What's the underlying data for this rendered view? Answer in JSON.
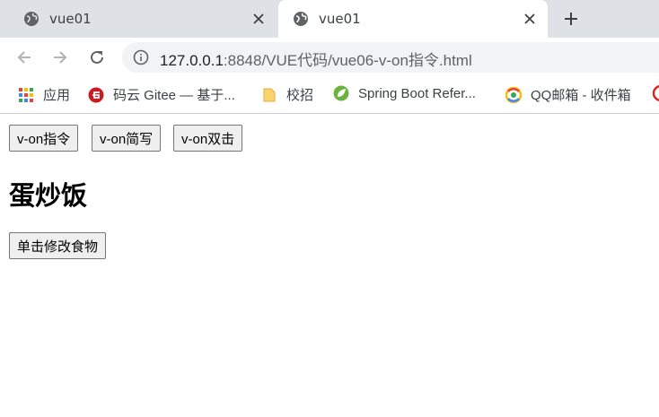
{
  "tabs": [
    {
      "title": "vue01",
      "active": false
    },
    {
      "title": "vue01",
      "active": true
    }
  ],
  "url": {
    "host": "127.0.0.1",
    "rest": ":8848/VUE代码/vue06-v-on指令.html"
  },
  "bookmarks": [
    "应用",
    "码云 Gitee — 基于...",
    "校招",
    "Spring Boot Refer...",
    "QQ邮箱 - 收件箱"
  ],
  "page": {
    "buttons": [
      "v-on指令",
      "v-on简写",
      "v-on双击"
    ],
    "food": "蛋炒饭",
    "change_button": "单击修改食物"
  }
}
